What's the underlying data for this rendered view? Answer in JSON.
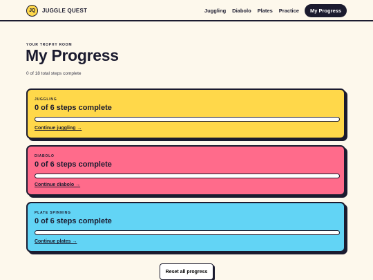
{
  "brand": {
    "logo_text": "JQ",
    "name": "JUGGLE QUEST"
  },
  "nav": {
    "links": [
      "Juggling",
      "Diabolo",
      "Plates",
      "Practice"
    ],
    "active": "My Progress"
  },
  "header": {
    "eyebrow": "YOUR TROPHY ROOM",
    "title": "My Progress",
    "summary": "0 of 18 total steps complete"
  },
  "cards": [
    {
      "eyebrow": "JUGGLING",
      "title": "0 of 6 steps complete",
      "progress": 0,
      "link": "Continue juggling →",
      "color": "#ffd84a"
    },
    {
      "eyebrow": "DIABOLO",
      "title": "0 of 6 steps complete",
      "progress": 0,
      "link": "Continue diabolo →",
      "color": "#ff6b8b"
    },
    {
      "eyebrow": "PLATE SPINNING",
      "title": "0 of 6 steps complete",
      "progress": 0,
      "link": "Continue plates →",
      "color": "#62d4f5"
    }
  ],
  "reset_label": "Reset all progress"
}
